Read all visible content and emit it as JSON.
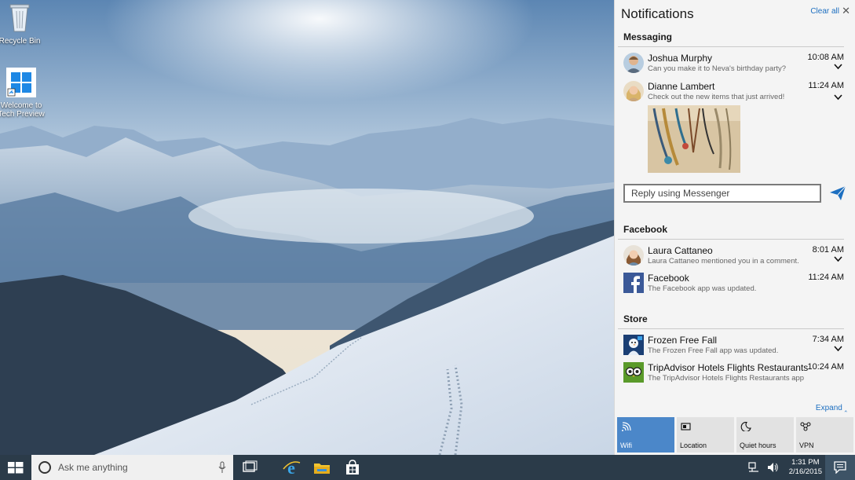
{
  "desktop": {
    "icons": [
      {
        "label": "Recycle Bin",
        "icon": "recycle-bin-icon"
      },
      {
        "label": "Welcome to Tech Preview",
        "icon": "windows-logo-icon"
      }
    ]
  },
  "action_center": {
    "title": "Notifications",
    "clear_all": "Clear all",
    "expand": "Expand",
    "groups": [
      {
        "name": "Messaging",
        "items": [
          {
            "name": "Joshua Murphy",
            "message": "Can you make it to Neva's birthday party?",
            "time": "10:08 AM"
          },
          {
            "name": "Dianne Lambert",
            "message": "Check out the new items that just arrived!",
            "time": "11:24 AM"
          }
        ],
        "reply_placeholder": "Reply using Messenger"
      },
      {
        "name": "Facebook",
        "items": [
          {
            "name": "Laura Cattaneo",
            "message": "Laura Cattaneo mentioned you in a comment.",
            "time": "8:01 AM"
          },
          {
            "name": "Facebook",
            "message": "The Facebook app was updated.",
            "time": "11:24 AM"
          }
        ]
      },
      {
        "name": "Store",
        "items": [
          {
            "name": "Frozen Free Fall",
            "message": "The Frozen Free Fall app was updated.",
            "time": "7:34 AM"
          },
          {
            "name": "TripAdvisor Hotels Flights Restaurants",
            "message": "The TripAdvisor Hotels Flights Restaurants app",
            "time": "10:24 AM"
          }
        ]
      }
    ],
    "quick_actions": [
      {
        "label": "Wifi",
        "icon": "wifi-icon",
        "active": true
      },
      {
        "label": "Location",
        "icon": "location-icon",
        "active": false
      },
      {
        "label": "Quiet hours",
        "icon": "moon-icon",
        "active": false
      },
      {
        "label": "VPN",
        "icon": "vpn-icon",
        "active": false
      }
    ]
  },
  "taskbar": {
    "search_placeholder": "Ask me anything",
    "apps": [
      "task-view-icon",
      "internet-explorer-icon",
      "file-explorer-icon",
      "store-icon"
    ],
    "clock_time": "1:31 PM",
    "clock_date": "2/16/2015"
  },
  "colors": {
    "accent": "#4b87c9",
    "taskbar": "#2b3b49",
    "link": "#1d6fc0"
  }
}
